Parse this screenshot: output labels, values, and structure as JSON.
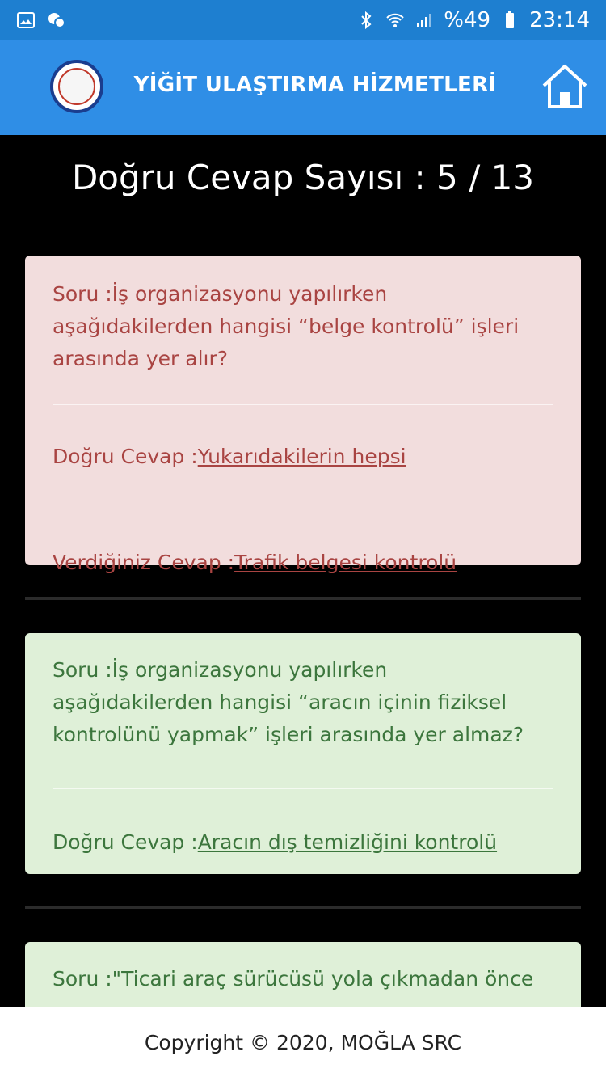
{
  "status_bar": {
    "battery": "%49",
    "time": "23:14",
    "icons": [
      "image-icon",
      "chat-icon",
      "bluetooth-icon",
      "wifi-icon",
      "signal-icon",
      "battery-icon"
    ]
  },
  "app_bar": {
    "title": "YİĞİT ULAŞTIRMA HİZMETLERİ",
    "home_icon": "home-icon"
  },
  "score": {
    "text": "Doğru Cevap Sayısı : 5 / 13"
  },
  "results": [
    {
      "status": "wrong",
      "question_prefix": "Soru :",
      "question": "İş organizasyonu yapılırken aşağıdakilerden hangisi “belge kontrolü” işleri arasında yer alır?",
      "correct_prefix": "Doğru Cevap :",
      "correct_answer": "Yukarıdakilerin hepsi",
      "given_prefix": "Verdiğiniz Cevap :",
      "given_answer": "Trafik belgesi kontrolü"
    },
    {
      "status": "correct",
      "question_prefix": "Soru :",
      "question": "İş organizasyonu yapılırken aşağıdakilerden hangisi “aracın içinin fiziksel kontrolünü yapmak” işleri arasında yer almaz?",
      "correct_prefix": "Doğru Cevap :",
      "correct_answer": "Aracın dış temizliğini kontrolü"
    },
    {
      "status": "correct",
      "question_prefix": "Soru :",
      "question": "\"Ticari araç sürücüsü yola çıkmadan önce"
    }
  ],
  "footer": {
    "text": "Copyright © 2020, MOĞLA SRC"
  },
  "colors": {
    "app_bar": "#2f8ee6",
    "status_bar": "#1e7fd0",
    "wrong_bg": "#f2dddd",
    "wrong_text": "#a94442",
    "correct_bg": "#dff0d8",
    "correct_text": "#3c763d"
  }
}
